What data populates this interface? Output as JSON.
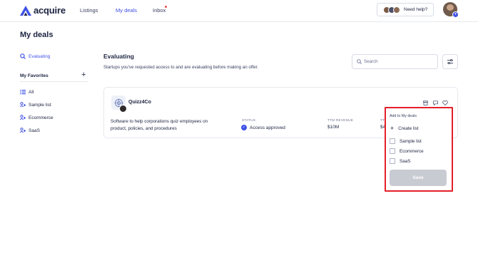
{
  "brand": {
    "name": "acquire",
    "accent": "#3f51e6"
  },
  "nav": {
    "links": [
      "Listings",
      "My deals",
      "Inbox"
    ],
    "active": "My deals",
    "help_label": "Need help?"
  },
  "page": {
    "title": "My deals"
  },
  "sidebar": {
    "primary": [
      {
        "label": "Evaluating",
        "icon": "magnifier-icon",
        "active": true
      }
    ],
    "favorites_title": "My Favorites",
    "favorites": [
      {
        "label": "All",
        "icon": "list-icon"
      },
      {
        "label": "Sample list",
        "icon": "people-icon"
      },
      {
        "label": "Ecommerce",
        "icon": "people-icon"
      },
      {
        "label": "SaaS",
        "icon": "people-icon"
      }
    ]
  },
  "main": {
    "title": "Evaluating",
    "subtitle": "Startups you've requested access to and are evaluating before making an offer.",
    "search_placeholder": "Search"
  },
  "deal": {
    "name": "Quizz4Co",
    "description": "Software to help corporations quiz employees on product, policies, and procedures",
    "status_label": "STATUS",
    "status_value": "Access approved",
    "revenue_label": "TTM REVENUE",
    "revenue_value": "$10M",
    "third_label": "TTI",
    "third_value": "$4"
  },
  "dropdown": {
    "title": "Add to My deals",
    "create_label": "Create list",
    "options": [
      "Sample list",
      "Ecommerce",
      "SaaS"
    ],
    "save_label": "Save",
    "highlight_color": "#e3202a"
  }
}
